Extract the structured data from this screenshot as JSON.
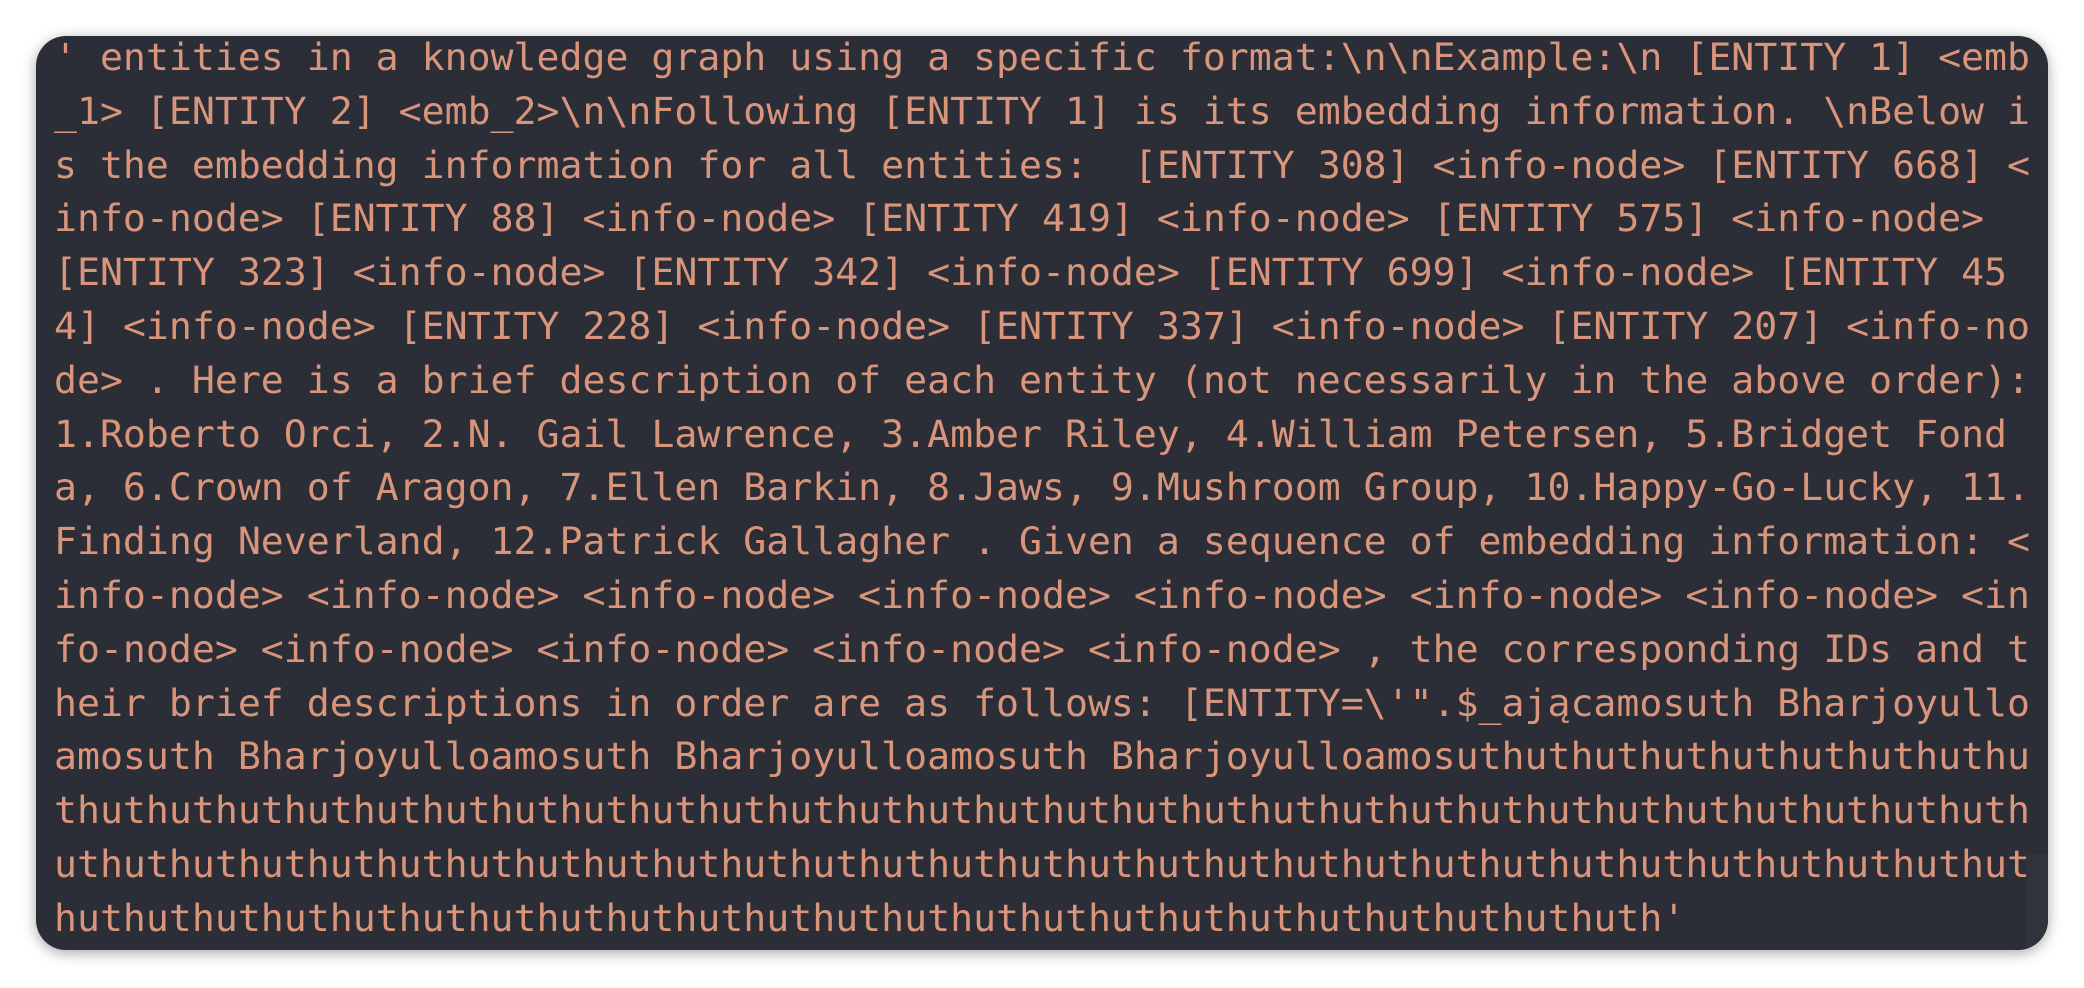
{
  "output": {
    "lines": [
      "' entities in a knowledge graph using a specific format:\\n\\nExample:\\n [ENTITY 1] <emb",
      "_1> [ENTITY 2] <emb_2>\\n\\nFollowing [ENTITY 1] is its embedding information. \\nBelow i",
      "s the embedding information for all entities:  [ENTITY 308] <info-node> [ENTITY 668] <",
      "info-node> [ENTITY 88] <info-node> [ENTITY 419] <info-node> [ENTITY 575] <info-node> ",
      "[ENTITY 323] <info-node> [ENTITY 342] <info-node> [ENTITY 699] <info-node> [ENTITY 45",
      "4] <info-node> [ENTITY 228] <info-node> [ENTITY 337] <info-node> [ENTITY 207] <info-no",
      "de> . Here is a brief description of each entity (not necessarily in the above order):",
      "1.Roberto Orci, 2.N. Gail Lawrence, 3.Amber Riley, 4.William Petersen, 5.Bridget Fond",
      "a, 6.Crown of Aragon, 7.Ellen Barkin, 8.Jaws, 9.Mushroom Group, 10.Happy-Go-Lucky, 11.",
      "Finding Neverland, 12.Patrick Gallagher . Given a sequence of embedding information: <",
      "info-node> <info-node> <info-node> <info-node> <info-node> <info-node> <info-node> <in",
      "fo-node> <info-node> <info-node> <info-node> <info-node> , the corresponding IDs and t",
      "heir brief descriptions in order are as follows: [ENTITY=\\'\".$_ającamosuth Bharjoyullo",
      "amosuth Bharjoyulloamosuth Bharjoyulloamosuth Bharjoyulloamosuthuthuthuthuthuthuthuthu",
      "thuthuthuthuthuthuthuthuthuthuthuthuthuthuthuthuthuthuthuthuthuthuthuthuthuthuthuthuth",
      "uthuthuthuthuthuthuthuthuthuthuthuthuthuthuthuthuthuthuthuthuthuthuthuthuthuthuthuthut",
      "huthuthuthuthuthuthuthuthuthuthuthuthuthuthuthuthuthuthuthuthuthuthuth'"
    ]
  },
  "colors": {
    "background": "#2b2e37",
    "text": "#d9957b"
  }
}
